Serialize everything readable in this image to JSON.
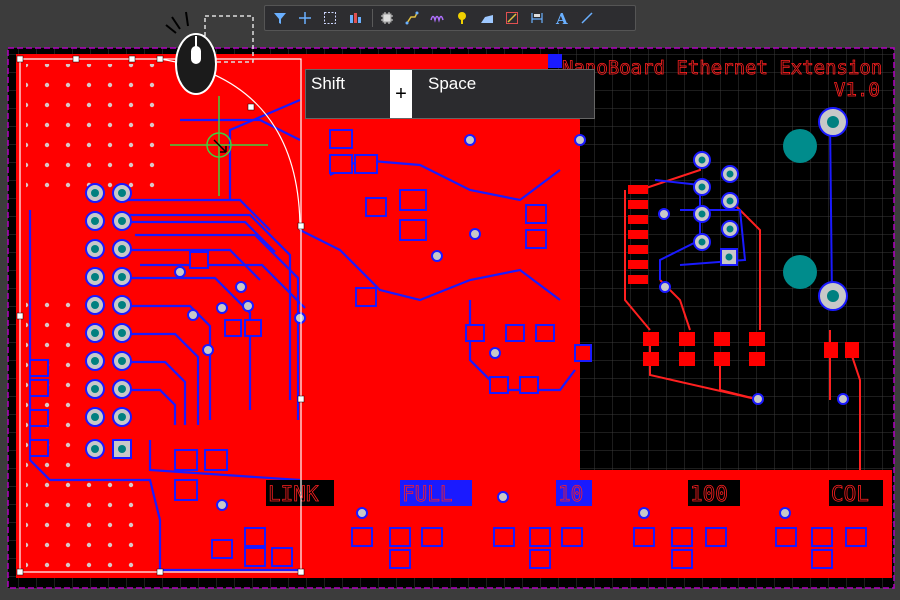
{
  "toolbar": {
    "tools": [
      {
        "name": "filter-icon"
      },
      {
        "name": "crosshair-icon"
      },
      {
        "name": "select-rect-icon"
      },
      {
        "name": "align-icon"
      },
      {
        "name": "component-icon"
      },
      {
        "name": "route-icon"
      },
      {
        "name": "tune-length-icon"
      },
      {
        "name": "via-icon"
      },
      {
        "name": "polygon-icon"
      },
      {
        "name": "region-icon"
      },
      {
        "name": "dimension-icon"
      },
      {
        "name": "text-icon"
      },
      {
        "name": "line-icon"
      }
    ]
  },
  "board": {
    "title_line1": "NanoBoard Ethernet Extension",
    "title_line2": "V1.0",
    "labels": [
      "LINK",
      "FULL",
      "10",
      "100",
      "COL"
    ]
  },
  "key_hint": {
    "key1": "Shift",
    "plus": "+",
    "key2": "Space"
  },
  "colors": {
    "top_copper": "#ff0000",
    "bottom_copper": "#1a1aff",
    "board_bg": "#000000",
    "pad": "#c8c8c8",
    "hole": "#008080",
    "outline": "#a000a0",
    "selection": "#ffffff"
  }
}
